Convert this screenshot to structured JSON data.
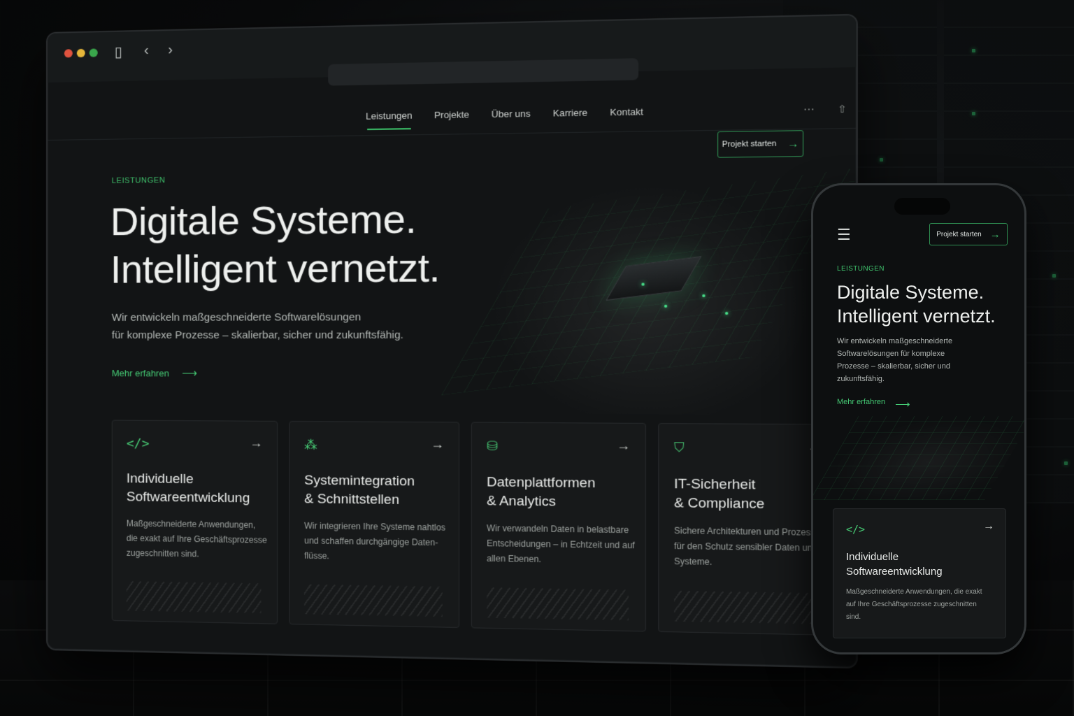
{
  "colors": {
    "accent": "#3cc46a",
    "background": "#121415",
    "card": "#17191a"
  },
  "browser": {
    "nav": [
      "Leistungen",
      "Projekte",
      "Über uns",
      "Karriere",
      "Kontakt"
    ],
    "active_nav": "Leistungen",
    "cta_label": "Projekt starten",
    "eyebrow": "LEISTUNGEN",
    "headline_line1": "Digitale Systeme.",
    "headline_line2": "Intelligent vernetzt.",
    "lead_line1": "Wir entwickeln maßgeschneiderte Softwarelösungen",
    "lead_line2": "für komplexe Prozesse – skalierbar, sicher und zukunftsfähig.",
    "more_label": "Mehr erfahren",
    "cards": [
      {
        "icon": "code-icon",
        "title_line1": "Individuelle",
        "title_line2": "Softwareentwicklung",
        "desc": "Maßgeschneiderte Anwendungen, die exakt auf Ihre Geschäftsprozesse zugeschnitten sind."
      },
      {
        "icon": "network-icon",
        "title_line1": "Systemintegration",
        "title_line2": "& Schnittstellen",
        "desc": "Wir integrieren Ihre Systeme nahtlos und schaffen durchgängige Daten-flüsse."
      },
      {
        "icon": "database-icon",
        "title_line1": "Datenplattformen",
        "title_line2": "& Analytics",
        "desc": "Wir verwandeln Daten in belastbare Entscheidungen – in Echtzeit und auf allen Ebenen."
      },
      {
        "icon": "shield-icon",
        "title_line1": "IT-Sicherheit",
        "title_line2": "& Compliance",
        "desc": "Sichere Architekturen und Prozesse für den Schutz sensibler Daten und Systeme."
      }
    ]
  },
  "phone": {
    "cta_label": "Projekt starten",
    "eyebrow": "LEISTUNGEN",
    "headline_line1": "Digitale Systeme.",
    "headline_line2": "Intelligent vernetzt.",
    "lead": "Wir entwickeln maßgeschneiderte Softwarelösungen für komplexe Prozesse – skalierbar, sicher und zukunftsfähig.",
    "more_label": "Mehr erfahren",
    "card": {
      "icon": "code-icon",
      "title_line1": "Individuelle",
      "title_line2": "Softwareentwicklung",
      "desc": "Maßgeschneiderte Anwendungen, die exakt auf Ihre Geschäftsprozesse zugeschnitten sind."
    }
  }
}
